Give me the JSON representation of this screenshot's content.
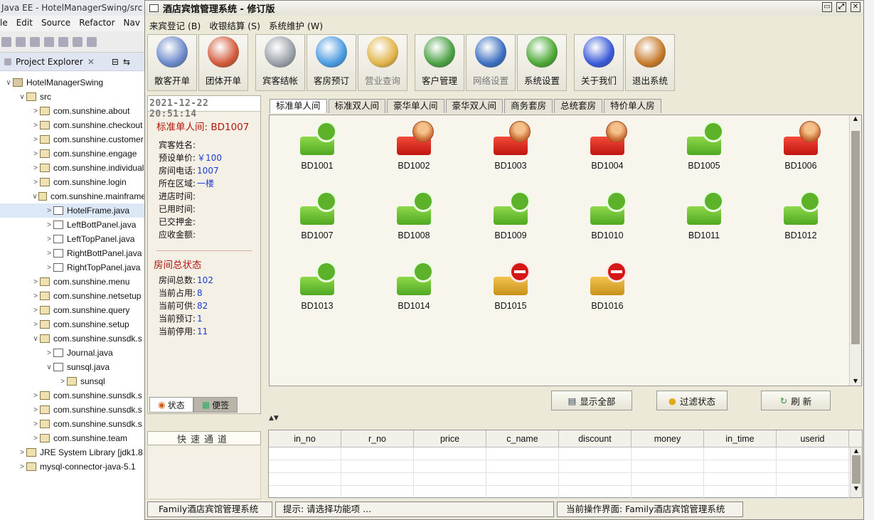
{
  "eclipse": {
    "title": "Java EE - HotelManagerSwing/src",
    "menu": [
      "le",
      "Edit",
      "Source",
      "Refactor",
      "Nav"
    ],
    "explorer_title": "Project Explorer",
    "tree": [
      {
        "label": "HotelManagerSwing",
        "indent": 0,
        "twisty": "∨",
        "icon": "proj"
      },
      {
        "label": "src",
        "indent": 1,
        "twisty": "∨",
        "icon": "pkg"
      },
      {
        "label": "com.sunshine.about",
        "indent": 2,
        "twisty": ">",
        "icon": "pkg"
      },
      {
        "label": "com.sunshine.checkout",
        "indent": 2,
        "twisty": ">",
        "icon": "pkg"
      },
      {
        "label": "com.sunshine.customer",
        "indent": 2,
        "twisty": ">",
        "icon": "pkg"
      },
      {
        "label": "com.sunshine.engage",
        "indent": 2,
        "twisty": ">",
        "icon": "pkg"
      },
      {
        "label": "com.sunshine.individual",
        "indent": 2,
        "twisty": ">",
        "icon": "pkg"
      },
      {
        "label": "com.sunshine.login",
        "indent": 2,
        "twisty": ">",
        "icon": "pkg"
      },
      {
        "label": "com.sunshine.mainframe",
        "indent": 2,
        "twisty": "∨",
        "icon": "pkg"
      },
      {
        "label": "HotelFrame.java",
        "indent": 3,
        "twisty": ">",
        "icon": "java",
        "selected": true
      },
      {
        "label": "LeftBottPanel.java",
        "indent": 3,
        "twisty": ">",
        "icon": "java"
      },
      {
        "label": "LeftTopPanel.java",
        "indent": 3,
        "twisty": ">",
        "icon": "java"
      },
      {
        "label": "RightBottPanel.java",
        "indent": 3,
        "twisty": ">",
        "icon": "java"
      },
      {
        "label": "RightTopPanel.java",
        "indent": 3,
        "twisty": ">",
        "icon": "java"
      },
      {
        "label": "com.sunshine.menu",
        "indent": 2,
        "twisty": ">",
        "icon": "pkg"
      },
      {
        "label": "com.sunshine.netsetup",
        "indent": 2,
        "twisty": ">",
        "icon": "pkg"
      },
      {
        "label": "com.sunshine.query",
        "indent": 2,
        "twisty": ">",
        "icon": "pkg"
      },
      {
        "label": "com.sunshine.setup",
        "indent": 2,
        "twisty": ">",
        "icon": "pkg"
      },
      {
        "label": "com.sunshine.sunsdk.s",
        "indent": 2,
        "twisty": "∨",
        "icon": "pkg"
      },
      {
        "label": "Journal.java",
        "indent": 3,
        "twisty": ">",
        "icon": "java"
      },
      {
        "label": "sunsql.java",
        "indent": 3,
        "twisty": "∨",
        "icon": "java"
      },
      {
        "label": "sunsql",
        "indent": 4,
        "twisty": ">",
        "icon": "class"
      },
      {
        "label": "com.sunshine.sunsdk.s",
        "indent": 2,
        "twisty": ">",
        "icon": "pkg"
      },
      {
        "label": "com.sunshine.sunsdk.s",
        "indent": 2,
        "twisty": ">",
        "icon": "pkg"
      },
      {
        "label": "com.sunshine.sunsdk.s",
        "indent": 2,
        "twisty": ">",
        "icon": "pkg"
      },
      {
        "label": "com.sunshine.team",
        "indent": 2,
        "twisty": ">",
        "icon": "pkg"
      },
      {
        "label": "JRE System Library [jdk1.8",
        "indent": 1,
        "twisty": ">",
        "icon": "lib"
      },
      {
        "label": "mysql-connector-java-5.1",
        "indent": 1,
        "twisty": ">",
        "icon": "lib"
      }
    ]
  },
  "app": {
    "title": "酒店宾馆管理系统 - 修订版",
    "menu": [
      "来宾登记 (B)",
      "收银结算 (S)",
      "系统维护 (W)"
    ],
    "toolbar": [
      {
        "label": "散客开单",
        "icon": "single-checkin-icon",
        "color": "#6a88c9",
        "disabled": false,
        "gap": false
      },
      {
        "label": "团体开单",
        "icon": "group-checkin-icon",
        "color": "#d25a3a",
        "disabled": false,
        "gap": false
      },
      {
        "label": "宾客结帐",
        "icon": "guest-checkout-icon",
        "color": "#9aa0a8",
        "disabled": false,
        "gap": true
      },
      {
        "label": "客房预订",
        "icon": "room-booking-icon",
        "color": "#4a9ae0",
        "disabled": false,
        "gap": false
      },
      {
        "label": "营业查询",
        "icon": "business-query-icon",
        "color": "#e2b44a",
        "disabled": true,
        "gap": false
      },
      {
        "label": "客户管理",
        "icon": "customer-manage-icon",
        "color": "#4aa044",
        "disabled": false,
        "gap": true
      },
      {
        "label": "网络设置",
        "icon": "network-settings-icon",
        "color": "#3b6fc0",
        "disabled": true,
        "gap": false
      },
      {
        "label": "系统设置",
        "icon": "system-settings-icon",
        "color": "#4ca834",
        "disabled": false,
        "gap": false
      },
      {
        "label": "关于我们",
        "icon": "about-us-icon",
        "color": "#3a5ad8",
        "disabled": false,
        "gap": true
      },
      {
        "label": "退出系统",
        "icon": "exit-system-icon",
        "color": "#c67a2a",
        "disabled": false,
        "gap": false
      }
    ],
    "left": {
      "datetime": "2021-12-22  20:51:14",
      "room_title": "标准单人间:  BD1007",
      "guest_fields": [
        {
          "label": "宾客姓名:",
          "value": ""
        },
        {
          "label": "预设单价:",
          "value": "￥100"
        },
        {
          "label": "房间电话:",
          "value": "1007"
        },
        {
          "label": "所在区域:",
          "value": "一楼"
        },
        {
          "label": "进店时间:",
          "value": ""
        },
        {
          "label": "已用时间:",
          "value": ""
        },
        {
          "label": "已交押金:",
          "value": ""
        },
        {
          "label": "应收金额:",
          "value": ""
        }
      ],
      "summary_title": "房间总状态",
      "summary": [
        {
          "label": "房间总数:",
          "value": "102"
        },
        {
          "label": "当前占用:",
          "value": "8"
        },
        {
          "label": "当前可供:",
          "value": "82"
        },
        {
          "label": "当前预订:",
          "value": "1"
        },
        {
          "label": "当前停用:",
          "value": "11"
        }
      ],
      "tabs": [
        "状态",
        "便签"
      ],
      "quick_channel": "快速通道"
    },
    "room_tabs": [
      "标准单人间",
      "标准双人间",
      "豪华单人间",
      "豪华双人间",
      "商务套房",
      "总统套房",
      "特价单人房"
    ],
    "rooms": [
      {
        "id": "BD1001",
        "status": "free"
      },
      {
        "id": "BD1002",
        "status": "occ"
      },
      {
        "id": "BD1003",
        "status": "occ"
      },
      {
        "id": "BD1004",
        "status": "occ"
      },
      {
        "id": "BD1005",
        "status": "free"
      },
      {
        "id": "BD1006",
        "status": "occ"
      },
      {
        "id": "BD1007",
        "status": "free"
      },
      {
        "id": "BD1008",
        "status": "free"
      },
      {
        "id": "BD1009",
        "status": "free"
      },
      {
        "id": "BD1010",
        "status": "free"
      },
      {
        "id": "BD1011",
        "status": "free"
      },
      {
        "id": "BD1012",
        "status": "free"
      },
      {
        "id": "BD1013",
        "status": "free"
      },
      {
        "id": "BD1014",
        "status": "free"
      },
      {
        "id": "BD1015",
        "status": "stop"
      },
      {
        "id": "BD1016",
        "status": "stop"
      }
    ],
    "actions": {
      "show_all": "显示全部",
      "filter": "过滤状态",
      "refresh": "刷  新"
    },
    "table_columns": [
      "in_no",
      "r_no",
      "price",
      "c_name",
      "discount",
      "money",
      "in_time",
      "userid"
    ],
    "status": {
      "app_name": "Family酒店宾馆管理系统",
      "hint": "提示: 请选择功能项 ...",
      "current": "当前操作界面:  Family酒店宾馆管理系统"
    }
  }
}
